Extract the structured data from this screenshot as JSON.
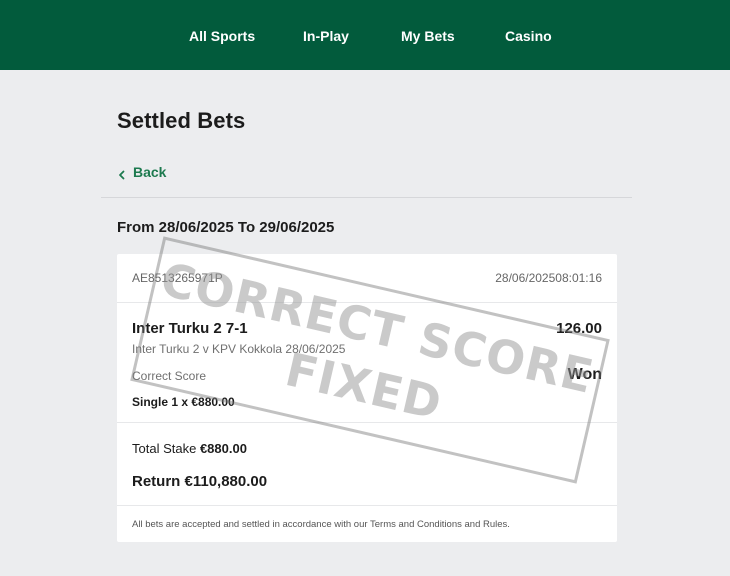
{
  "nav": {
    "items": [
      "All Sports",
      "In-Play",
      "My Bets",
      "Casino"
    ]
  },
  "page": {
    "title": "Settled Bets",
    "back_label": "Back",
    "date_range": "From 28/06/2025 To 29/06/2025"
  },
  "bet": {
    "reference": "AE8513265971P",
    "placed": "28/06/202508:01:16",
    "selection": "Inter Turku 2 7-1",
    "odds": "126.00",
    "event": "Inter Turku 2 v KPV Kokkola 28/06/2025",
    "market": "Correct Score",
    "result": "Won",
    "bet_type": "Single 1 x €880.00",
    "total_stake_label": "Total Stake",
    "total_stake_value": "€880.00",
    "return_label": "Return €110,880.00",
    "terms": "All bets are accepted and settled in accordance with our Terms and Conditions and Rules."
  },
  "stamp": {
    "line1": "CORRECT SCORE",
    "line2": "FIXED"
  },
  "colors": {
    "nav_bg": "#025B3C",
    "accent_green": "#1D7A4F",
    "page_bg": "#ECEDEF"
  }
}
